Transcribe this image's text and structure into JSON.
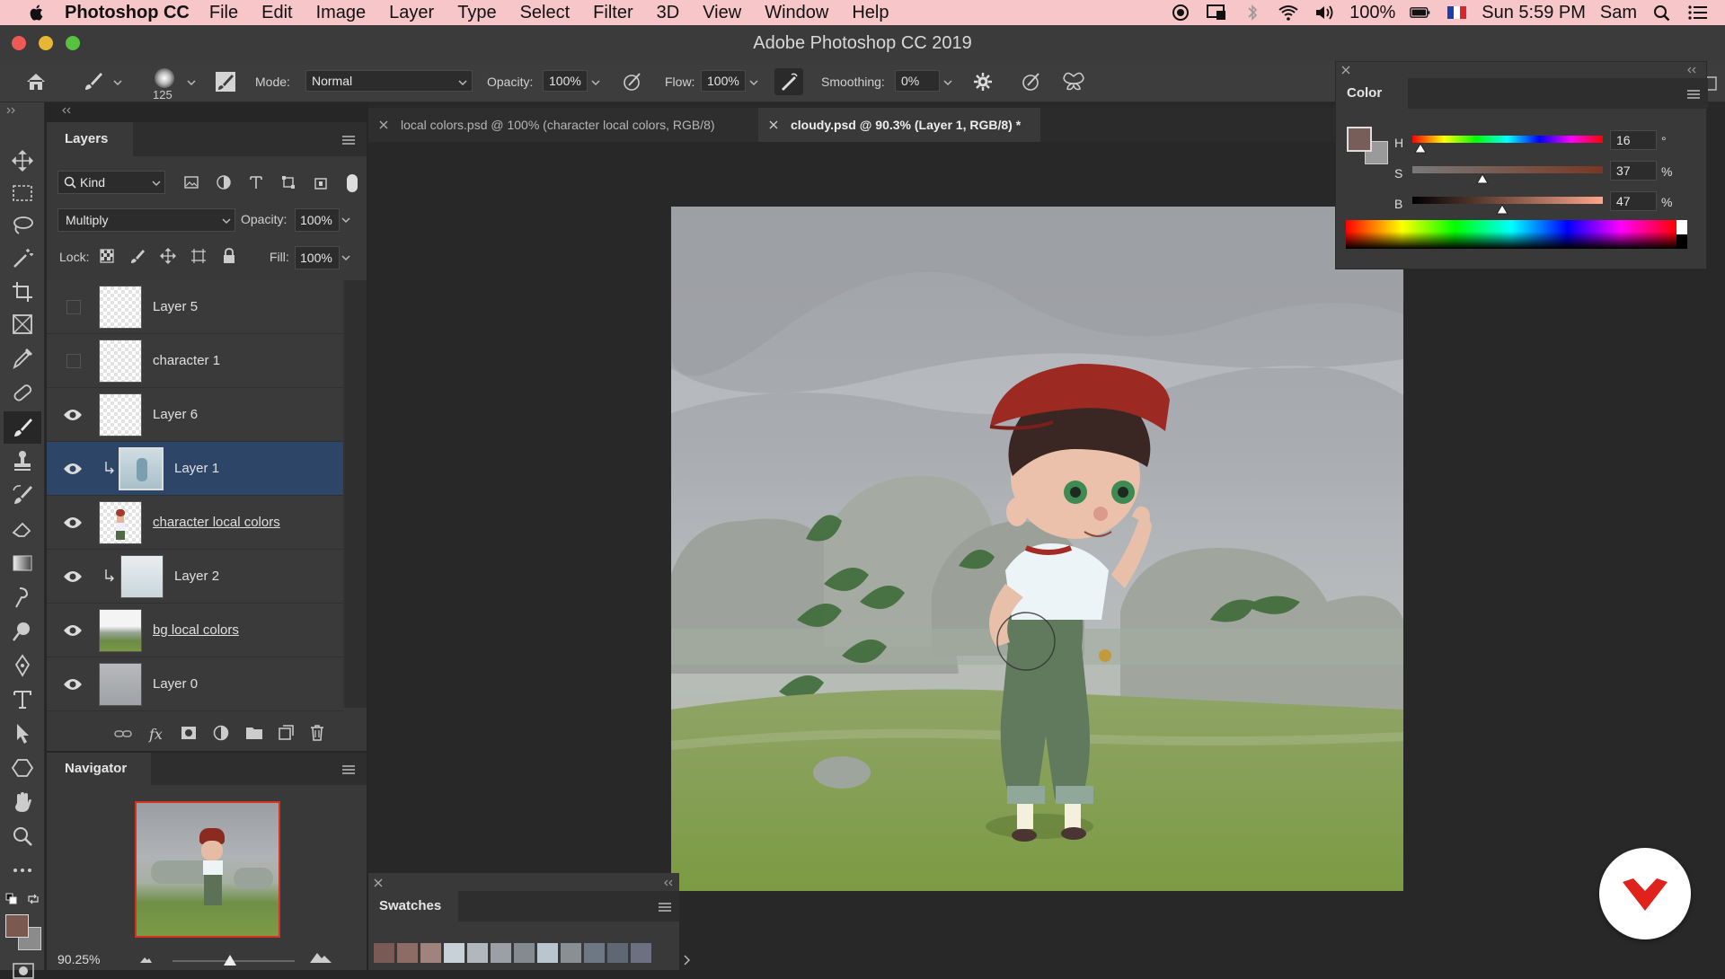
{
  "menubar": {
    "app": "Photoshop CC",
    "items": [
      "File",
      "Edit",
      "Image",
      "Layer",
      "Type",
      "Select",
      "Filter",
      "3D",
      "View",
      "Window",
      "Help"
    ],
    "battery": "100%",
    "clock": "Sun 5:59 PM",
    "user": "Sam"
  },
  "window": {
    "title": "Adobe Photoshop CC 2019"
  },
  "options": {
    "brush_size": "125",
    "mode_label": "Mode:",
    "mode_value": "Normal",
    "opacity_label": "Opacity:",
    "opacity_value": "100%",
    "flow_label": "Flow:",
    "flow_value": "100%",
    "smoothing_label": "Smoothing:",
    "smoothing_value": "0%"
  },
  "layers_panel": {
    "title": "Layers",
    "filter_label": "Kind",
    "blend_mode": "Multiply",
    "opacity_label": "Opacity:",
    "opacity_value": "100%",
    "lock_label": "Lock:",
    "fill_label": "Fill:",
    "fill_value": "100%",
    "layers": [
      {
        "name": "Layer 5",
        "visible": false
      },
      {
        "name": "character 1",
        "visible": false
      },
      {
        "name": "Layer 6",
        "visible": true
      },
      {
        "name": "Layer 1",
        "visible": true,
        "selected": true
      },
      {
        "name": "character local colors",
        "visible": true
      },
      {
        "name": "Layer 2",
        "visible": true
      },
      {
        "name": "bg local colors",
        "visible": true
      },
      {
        "name": "Layer 0",
        "visible": true
      }
    ]
  },
  "navigator": {
    "title": "Navigator",
    "zoom": "90.25%"
  },
  "doc_tabs": [
    {
      "label": "local colors.psd @ 100% (character local colors, RGB/8)",
      "active": false
    },
    {
      "label": "cloudy.psd @ 90.3% (Layer 1, RGB/8) *",
      "active": true
    }
  ],
  "color_panel": {
    "title": "Color",
    "h_label": "H",
    "h_value": "16",
    "h_unit": "°",
    "s_label": "S",
    "s_value": "37",
    "s_unit": "%",
    "b_label": "B",
    "b_value": "47",
    "b_unit": "%",
    "h_fraction": 0.044,
    "s_fraction": 0.37,
    "b_fraction": 0.47,
    "foreground_color": "#785e58",
    "background_color": "#9a9a9a"
  },
  "swatches": {
    "title": "Swatches",
    "colors": [
      "#7a5a55",
      "#8e6c66",
      "#a0837c",
      "#c9d1d8",
      "#b1b7bc",
      "#9aa0a5",
      "#838a90",
      "#b9c5cf",
      "#8a8f94",
      "#6e7884",
      "#5f6774",
      "#6d7080"
    ]
  },
  "tool_colors": {
    "foreground": "#7a5a50",
    "background": "#8b8b8b"
  }
}
